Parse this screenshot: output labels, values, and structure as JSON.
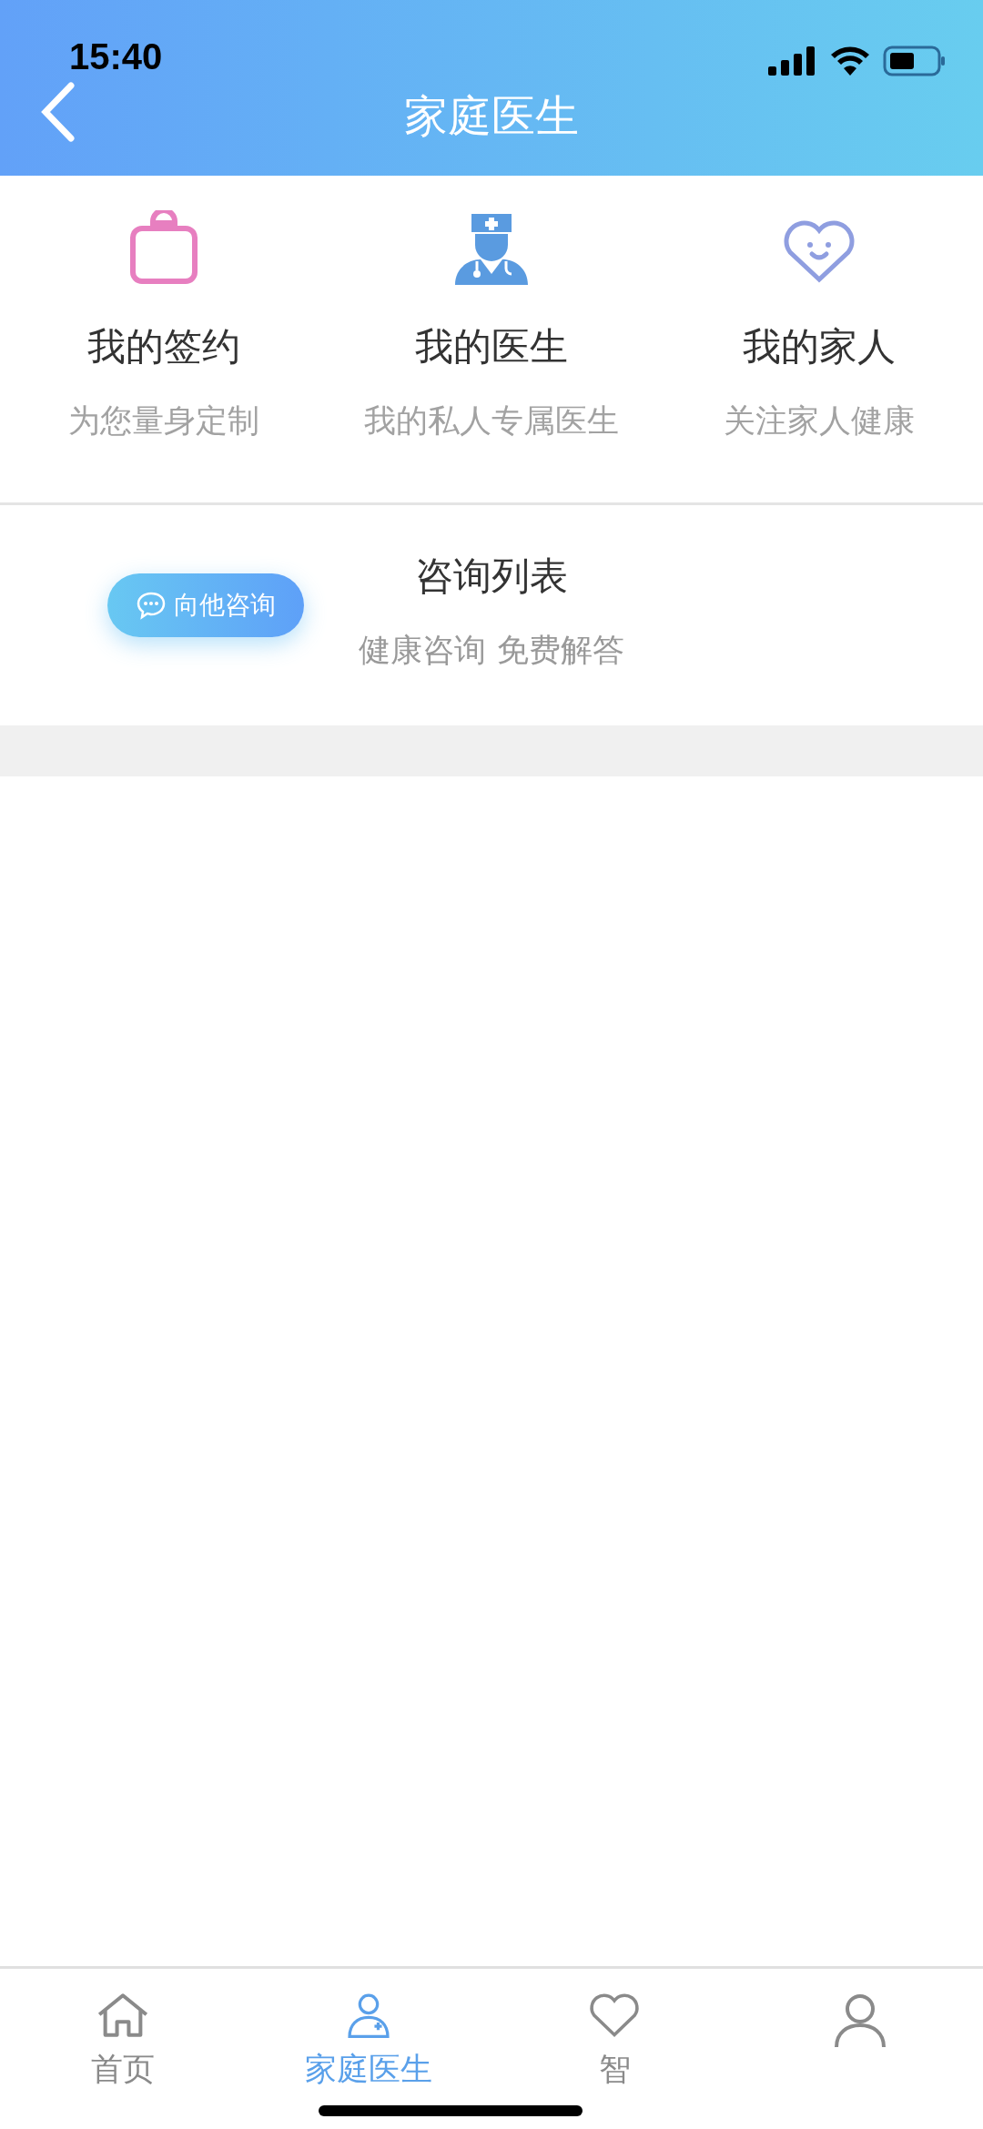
{
  "status_bar": {
    "time": "15:40"
  },
  "header": {
    "title": "家庭医生"
  },
  "features": [
    {
      "kind": "bag",
      "title": "我的签约",
      "subtitle": "为您量身定制"
    },
    {
      "kind": "doctor",
      "title": "我的医生",
      "subtitle": "我的私人专属医生"
    },
    {
      "kind": "heart",
      "title": "我的家人",
      "subtitle": "关注家人健康"
    }
  ],
  "consult": {
    "button": "向他咨询",
    "title": "咨询列表",
    "subtitle": "健康咨询 免费解答"
  },
  "tabs": [
    {
      "kind": "home",
      "label": "首页",
      "selected": false
    },
    {
      "kind": "doctor",
      "label": "家庭医生",
      "selected": true
    },
    {
      "kind": "heart",
      "label": "智",
      "selected": false
    },
    {
      "kind": "person",
      "selected": false
    }
  ]
}
